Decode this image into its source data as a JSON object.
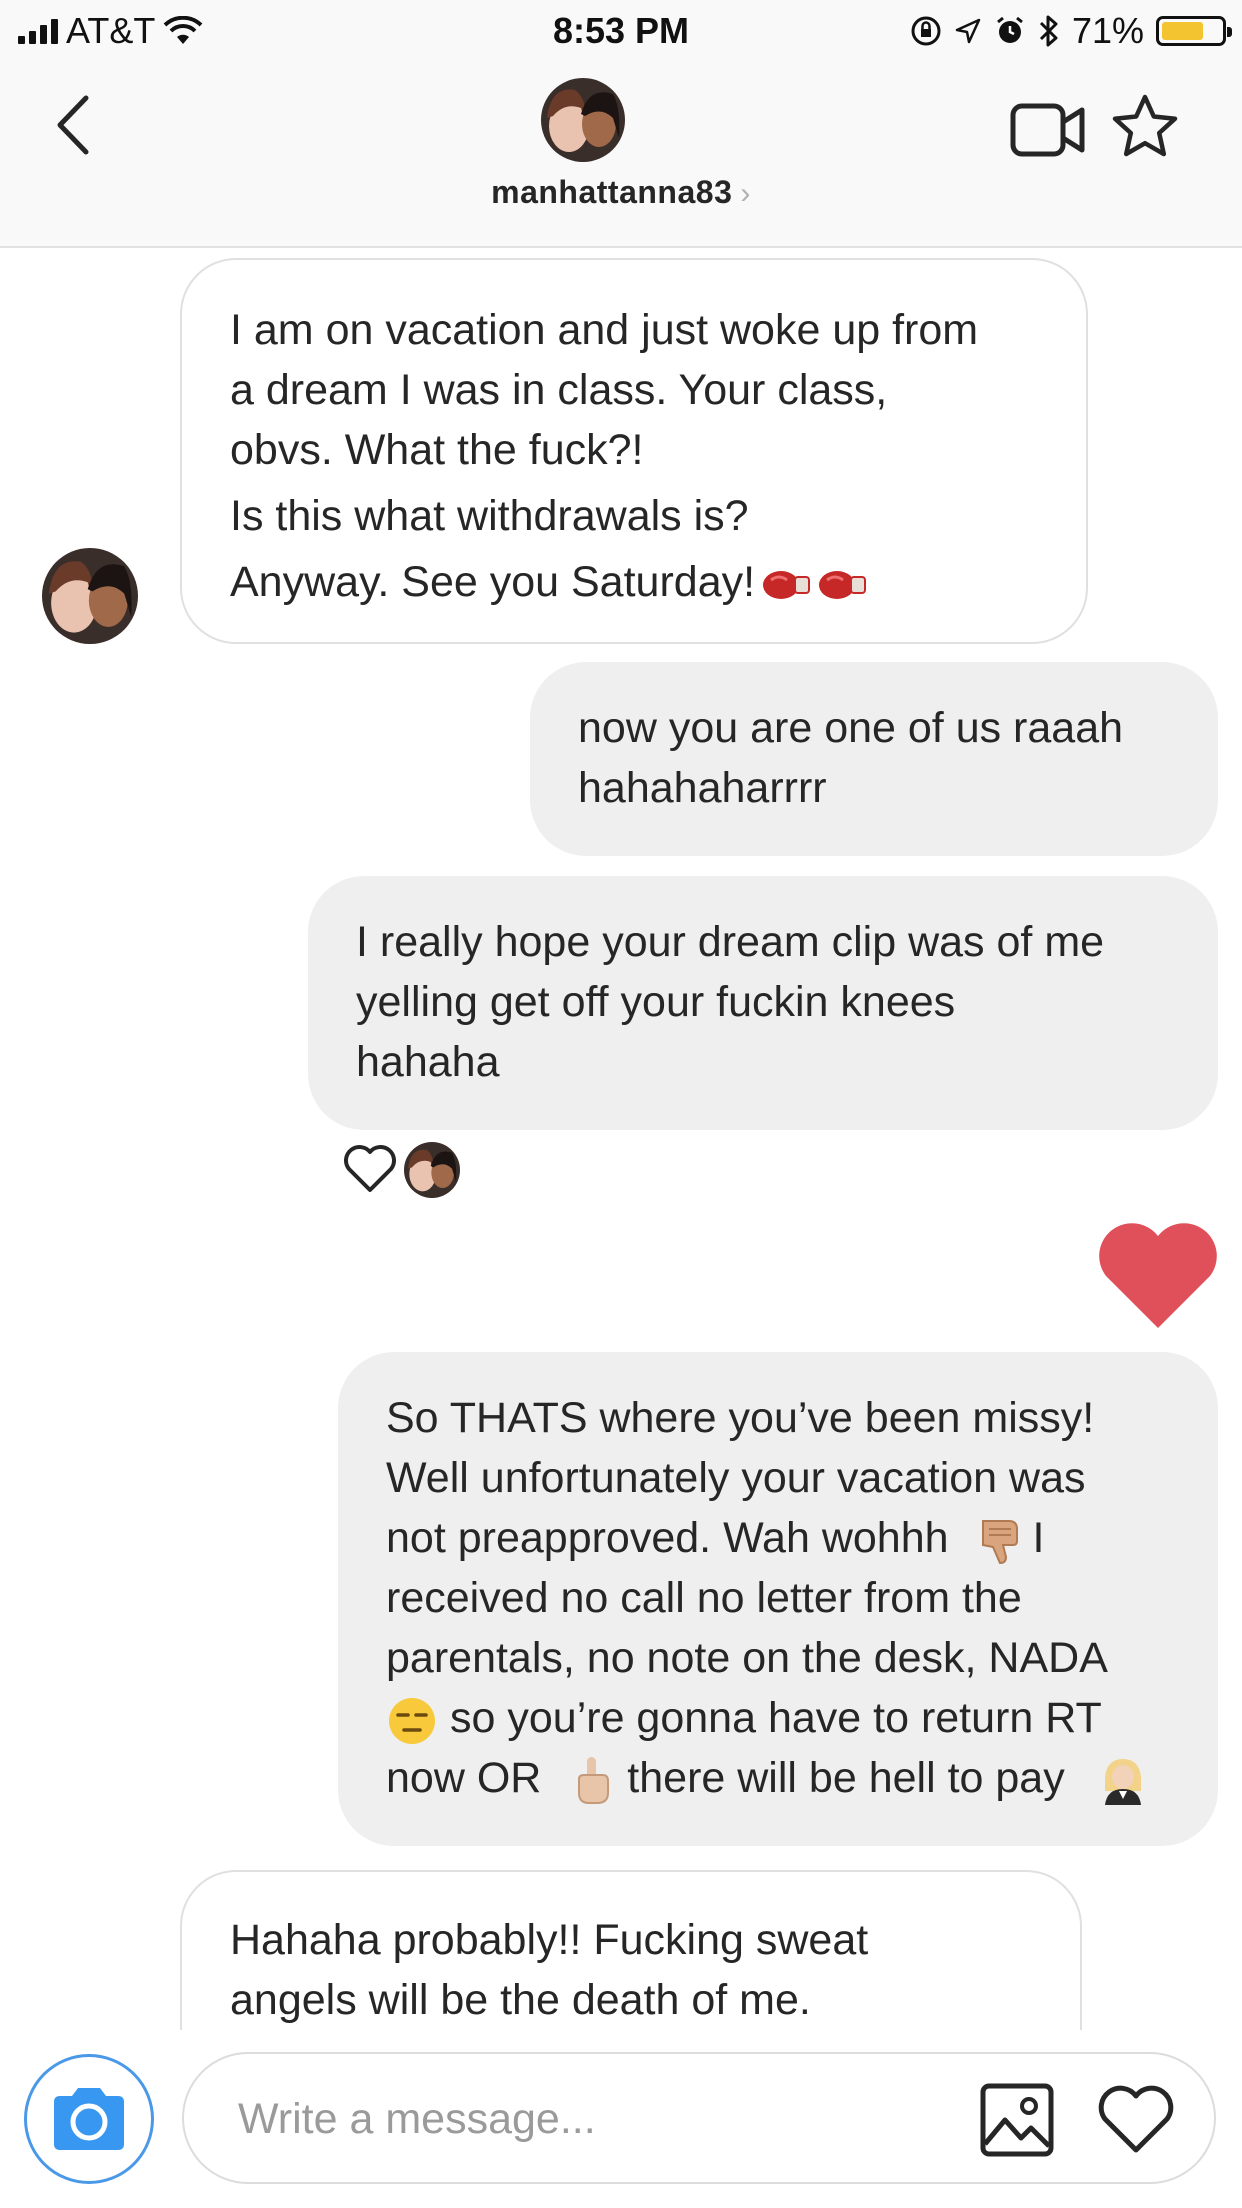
{
  "status_bar": {
    "carrier": "AT&T",
    "time": "8:53 PM",
    "battery_percent": "71%",
    "battery_level": 0.71,
    "icons": [
      "signal-icon",
      "wifi-icon",
      "orientation-lock-icon",
      "location-icon",
      "alarm-icon",
      "bluetooth-icon",
      "battery-icon"
    ]
  },
  "header": {
    "username": "manhattanna83",
    "chevron": "›",
    "icons": [
      "back-icon",
      "avatar",
      "video-camera-icon",
      "star-icon"
    ]
  },
  "messages": [
    {
      "direction": "incoming",
      "lines": [
        "I am on vacation and just woke up from",
        "a dream I was in class. Your class,",
        "obvs. What the fuck?!",
        "Is this what withdrawals is?",
        "Anyway. See you Saturday!"
      ],
      "trailing_emoji": [
        "boxing-glove-icon",
        "boxing-glove-icon"
      ]
    },
    {
      "direction": "outgoing",
      "lines": [
        "now you are one of us raaah",
        "hahahaharrrr"
      ]
    },
    {
      "direction": "outgoing",
      "lines": [
        "I really hope your dream clip was of me",
        "yelling get off your fuckin knees",
        "hahaha"
      ],
      "reaction": "heart-outline-icon"
    },
    {
      "direction": "outgoing",
      "type": "like",
      "icon": "red-heart-icon"
    },
    {
      "direction": "outgoing",
      "lines": [
        "So THATS where you’ve been missy!",
        "Well unfortunately your vacation was",
        "not preapproved. Wah wohhh",
        "received no call no letter from the",
        "parentals, no note on the desk, NADA",
        "so you’re gonna have to return RT",
        "now OR",
        "there will be hell to pay"
      ],
      "emoji": [
        "thumbs-down-icon",
        "expressionless-face-icon",
        "index-pointing-up-icon",
        "woman-judge-icon"
      ],
      "fragments": {
        "wah_suffix": "I"
      }
    },
    {
      "direction": "incoming",
      "lines": [
        "Hahaha probably!! Fucking sweat",
        "angels will be the death of me."
      ]
    }
  ],
  "composer": {
    "placeholder": "Write a message...",
    "icons": [
      "camera-icon",
      "gallery-icon",
      "heart-icon"
    ]
  },
  "colors": {
    "accent_blue": "#3897f0",
    "like_red": "#e0505a",
    "outgoing_bubble": "#efefef",
    "incoming_border": "#e0e0e0"
  }
}
